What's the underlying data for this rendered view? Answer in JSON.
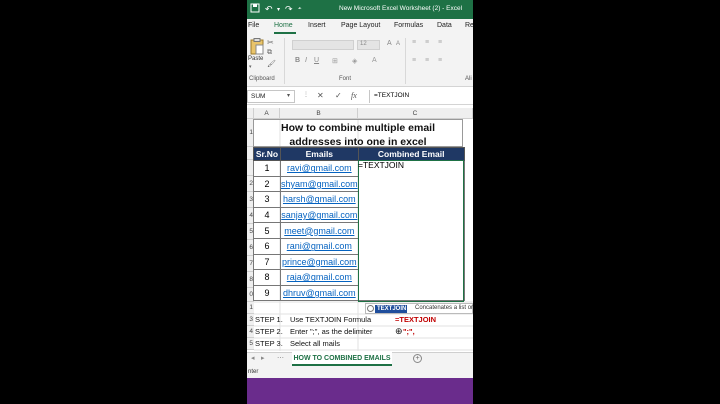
{
  "window": {
    "title": "New Microsoft Excel Worksheet (2)  -  Excel",
    "undo_icon": "undo-icon",
    "redo_icon": "redo-icon"
  },
  "ribbon": {
    "tabs": [
      "File",
      "Home",
      "Insert",
      "Page Layout",
      "Formulas",
      "Data",
      "Re"
    ],
    "active_tab": "Home",
    "paste_label": "Paste",
    "groups": [
      "Clipboard",
      "Font",
      "Ali"
    ],
    "font_size": "12"
  },
  "formula_bar": {
    "name_box": "SUM",
    "cancel": "✕",
    "enter": "✓",
    "fx": "fx",
    "formula": "=TEXTJOIN"
  },
  "columns": [
    "A",
    "B",
    "C"
  ],
  "rows": [
    "1",
    "",
    "2",
    "3",
    "4",
    "5",
    "6",
    "7",
    "8",
    "9",
    "0",
    "1",
    "2",
    "3",
    "4",
    "5"
  ],
  "sheet": {
    "heading": "How to combine multiple email addresses into one in excel",
    "headers": [
      "Sr.No",
      "Emails",
      "Combined Email"
    ],
    "entries": [
      {
        "no": "1",
        "email": "ravi@gmail.com"
      },
      {
        "no": "2",
        "email": "shyam@gmail.com"
      },
      {
        "no": "3",
        "email": "harsh@gmail.com"
      },
      {
        "no": "4",
        "email": "sanjay@gmail.com"
      },
      {
        "no": "5",
        "email": "meet@gmail.com"
      },
      {
        "no": "6",
        "email": "rani@gmail.com"
      },
      {
        "no": "7",
        "email": "prince@gmail.com"
      },
      {
        "no": "8",
        "email": "raja@gmail.com"
      },
      {
        "no": "9",
        "email": "dhruv@gmail.com"
      }
    ],
    "active_cell_value": "=TEXTJOIN"
  },
  "tooltip": {
    "function": "TEXTJOIN",
    "description": "Concatenates a list or"
  },
  "steps": [
    {
      "label": "STEP 1.",
      "text": "Use TEXTJOIN Formula",
      "value": "=TEXTJOIN"
    },
    {
      "label": "STEP 2.",
      "text": "Enter \";\",  as the delimiter",
      "value": "\";\","
    },
    {
      "label": "STEP 3.",
      "text": "Select all mails",
      "value": ""
    }
  ],
  "sheet_tab": "HOW TO COMBINED EMAILS",
  "add_sheet": "+",
  "status": "nter",
  "colors": {
    "excel_green": "#1e7145",
    "header_navy": "#1f3864",
    "link_blue": "#0563c1",
    "step_red": "#c00000",
    "banner_purple": "#6a2c8c"
  }
}
